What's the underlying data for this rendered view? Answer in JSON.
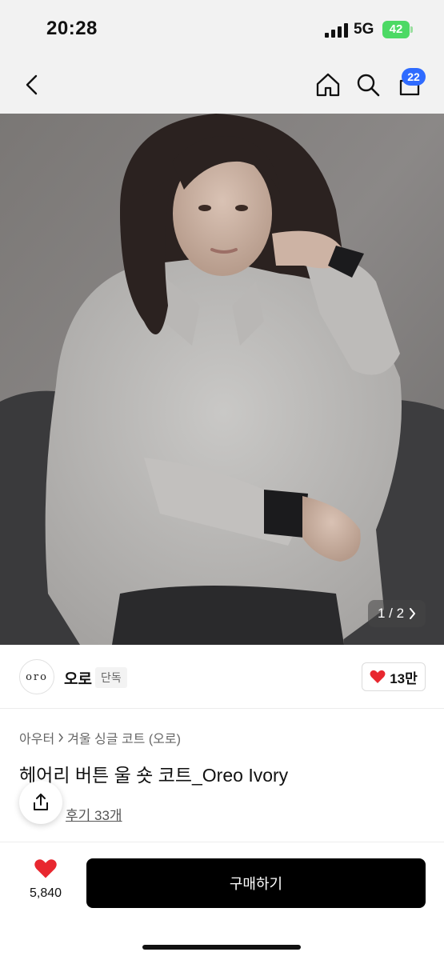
{
  "status_bar": {
    "time": "20:28",
    "network": "5G",
    "battery": "42"
  },
  "nav": {
    "cart_count": "22"
  },
  "gallery": {
    "counter": "1 / 2"
  },
  "brand": {
    "logo_text": "oro",
    "name": "오로",
    "tag": "단독",
    "likes": "13만"
  },
  "breadcrumb": {
    "category": "아우터",
    "subcategory": "겨울 싱글 코트 (오로)"
  },
  "product": {
    "title": "헤어리 버튼 울 숏 코트_Oreo Ivory",
    "reviews_label": "후기 33개"
  },
  "bottom_bar": {
    "wish_count": "5,840",
    "buy_label": "구매하기"
  },
  "colors": {
    "heart": "#e8272f",
    "badge": "#2f6bff",
    "battery": "#4cd964",
    "buy_button": "#000000"
  },
  "icons": [
    "back-icon",
    "home-icon",
    "search-icon",
    "cart-icon",
    "chevron-right-icon",
    "heart-icon",
    "share-icon"
  ]
}
